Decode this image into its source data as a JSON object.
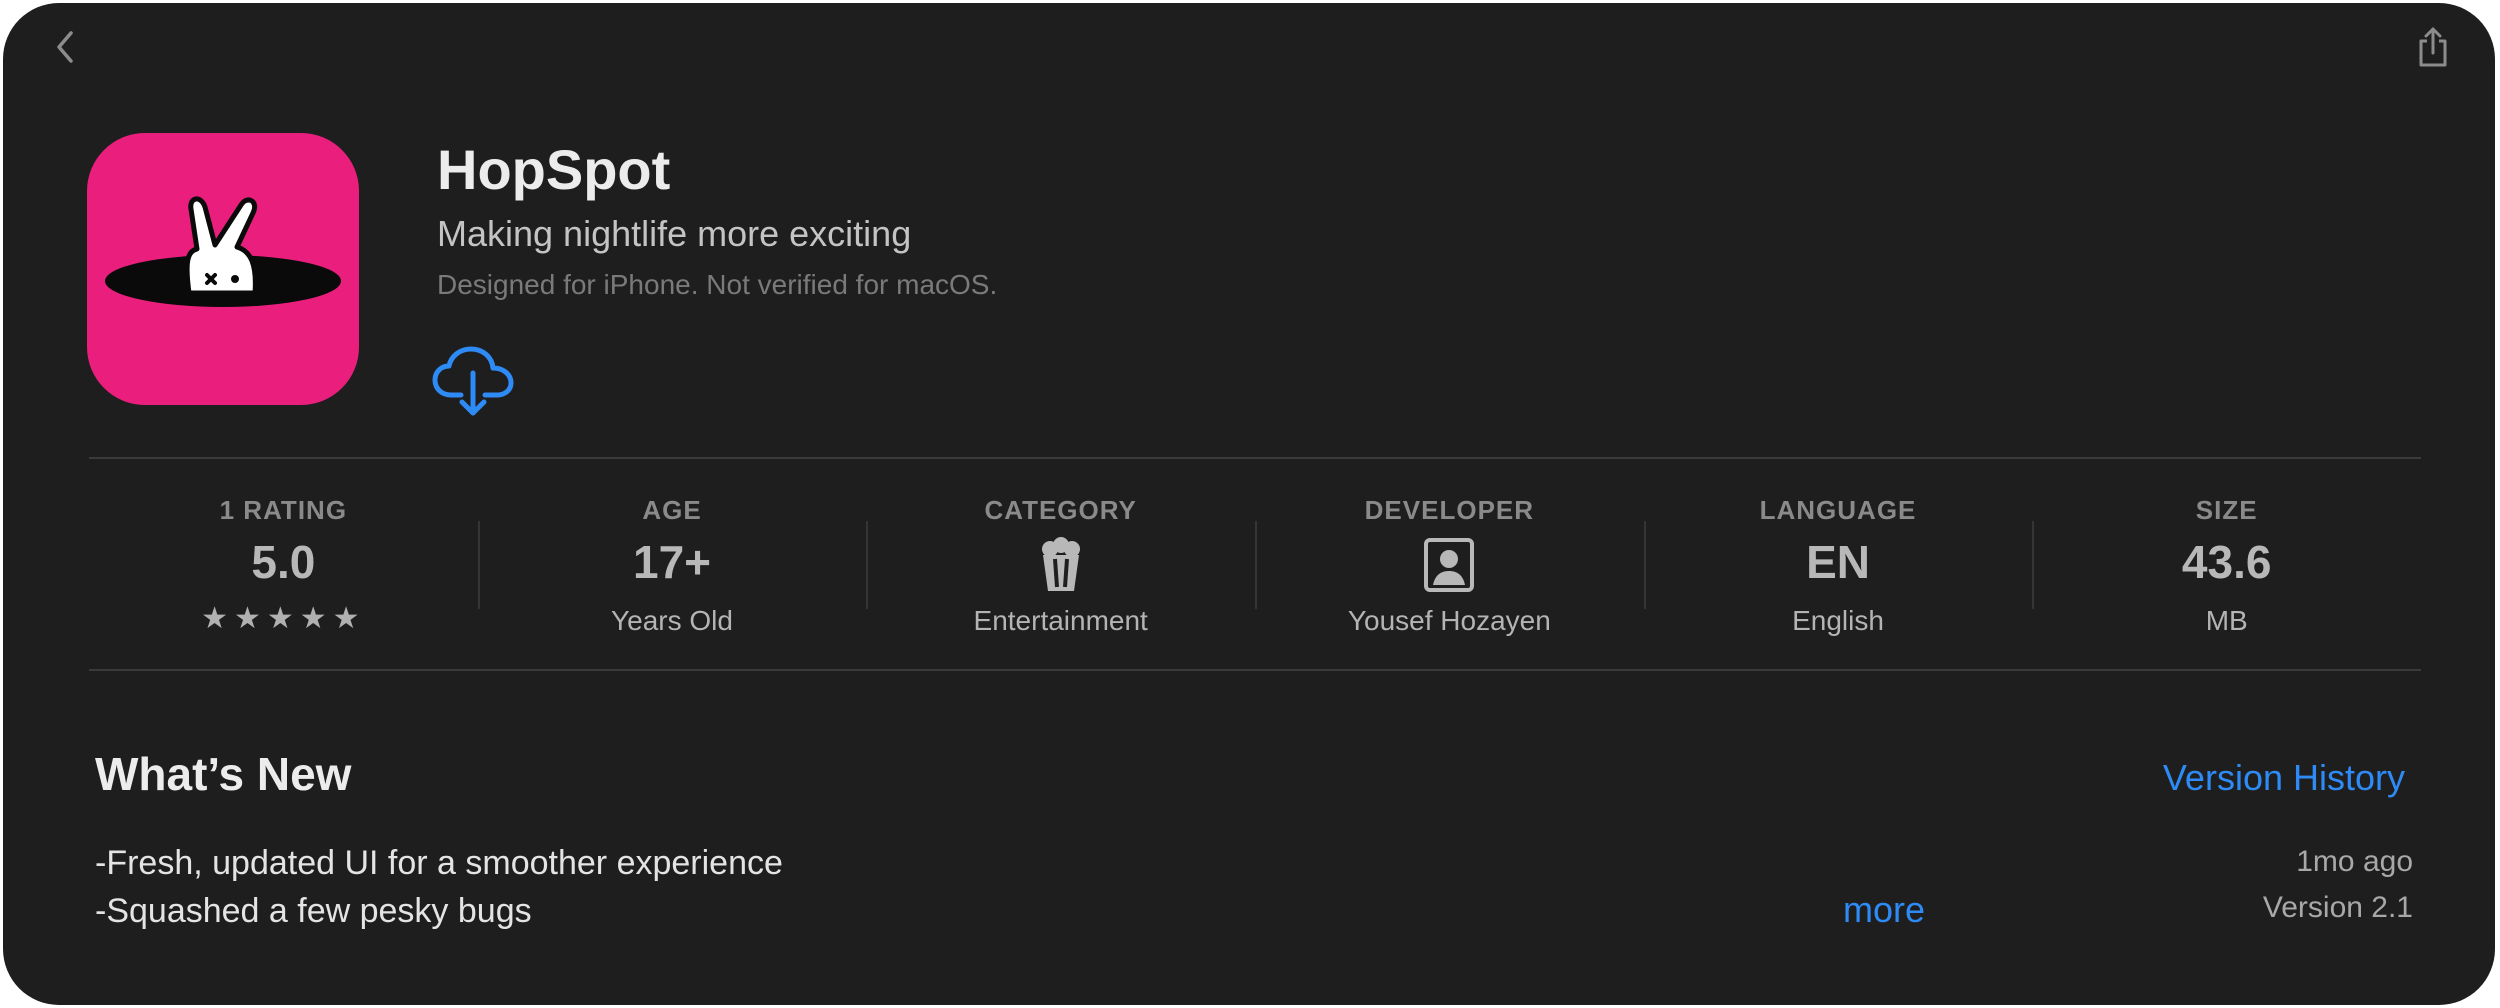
{
  "icons": {
    "back": "chevron-left-icon",
    "share": "share-icon",
    "download": "cloud-download-icon",
    "category": "popcorn-icon",
    "developer": "person-icon"
  },
  "colors": {
    "background": "#1e1e1e",
    "app_icon_bg": "#ea1f7d",
    "accent": "#2e8bf5"
  },
  "app": {
    "name": "HopSpot",
    "subtitle": "Making nightlife more exciting",
    "note": "Designed for iPhone. Not verified for macOS."
  },
  "stats": {
    "rating": {
      "label": "1 RATING",
      "value": "5.0",
      "stars": "★★★★★",
      "stars_count": 5
    },
    "age": {
      "label": "AGE",
      "value": "17+",
      "sub": "Years Old"
    },
    "category": {
      "label": "CATEGORY",
      "sub": "Entertainment"
    },
    "developer": {
      "label": "DEVELOPER",
      "sub": "Yousef Hozayen"
    },
    "language": {
      "label": "LANGUAGE",
      "value": "EN",
      "sub": "English"
    },
    "size": {
      "label": "SIZE",
      "value": "43.6",
      "sub": "MB"
    }
  },
  "whats_new": {
    "title": "What’s New",
    "version_history_label": "Version History",
    "notes": [
      "-Fresh, updated UI for a smoother experience",
      "-Squashed a few pesky bugs"
    ],
    "more_label": "more",
    "date": "1mo ago",
    "version": "Version 2.1"
  }
}
